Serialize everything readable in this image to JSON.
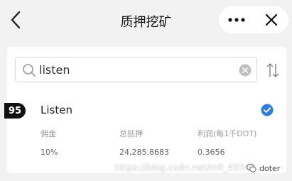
{
  "header": {
    "title": "质押挖矿"
  },
  "search": {
    "value": "listen",
    "placeholder": ""
  },
  "validator": {
    "rank": "95",
    "name": "Listen",
    "columns": [
      {
        "label": "佣金",
        "value": "10%"
      },
      {
        "label": "总抵押",
        "value": "24,285.8683"
      },
      {
        "label": "利润(每1千DOT)",
        "value": "0.3656"
      }
    ],
    "selected": true
  },
  "watermark": {
    "url": "https://blog.csdn.net/m0_49346",
    "brand": "doter"
  },
  "colors": {
    "background": "#f2f2f2",
    "card": "#ffffff",
    "accent": "#2f7fd6",
    "badge": "#111111"
  }
}
